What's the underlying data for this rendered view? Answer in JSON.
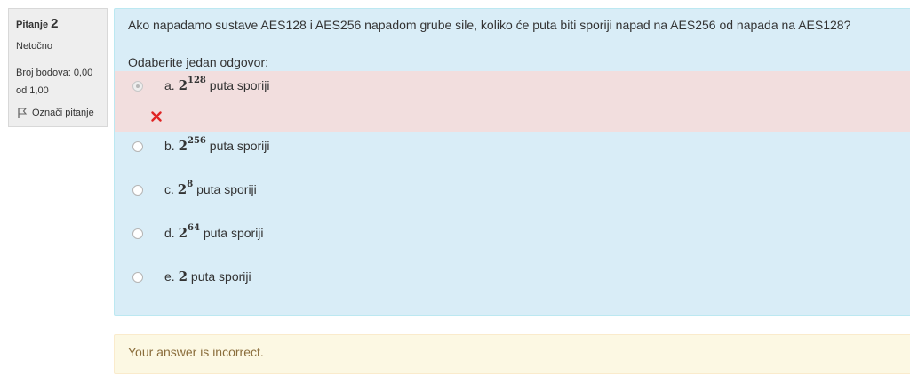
{
  "info": {
    "question_label": "Pitanje",
    "question_number": "2",
    "state": "Netočno",
    "grade_line1": "Broj bodova: 0,00",
    "grade_line2": "od 1,00",
    "flag_label": "Označi pitanje",
    "flag_icon": "flag-icon"
  },
  "question": {
    "text": "Ako napadamo sustave AES128 i AES256 napadom grube sile, koliko će puta biti sporiji napad na AES256 od napada na AES128?",
    "prompt": "Odaberite jedan odgovor:"
  },
  "answers": [
    {
      "letter": "a.",
      "base": "2",
      "exp": "128",
      "suffix": " puta sporiji",
      "selected": true,
      "result": "incorrect"
    },
    {
      "letter": "b.",
      "base": "2",
      "exp": "256",
      "suffix": " puta sporiji",
      "selected": false
    },
    {
      "letter": "c.",
      "base": "2",
      "exp": "8",
      "suffix": " puta sporiji",
      "selected": false
    },
    {
      "letter": "d.",
      "base": "2",
      "exp": "64",
      "suffix": " puta sporiji",
      "selected": false
    },
    {
      "letter": "e.",
      "base": "2",
      "exp": "",
      "suffix": " puta sporiji",
      "selected": false
    }
  ],
  "feedback": {
    "text": "Your answer is incorrect."
  },
  "colors": {
    "formulation_bg": "#d9edf7",
    "incorrect_bg": "#f2dede",
    "feedback_bg": "#fcf8e3",
    "feedback_text": "#8a6d3b",
    "cross": "#e02424"
  }
}
